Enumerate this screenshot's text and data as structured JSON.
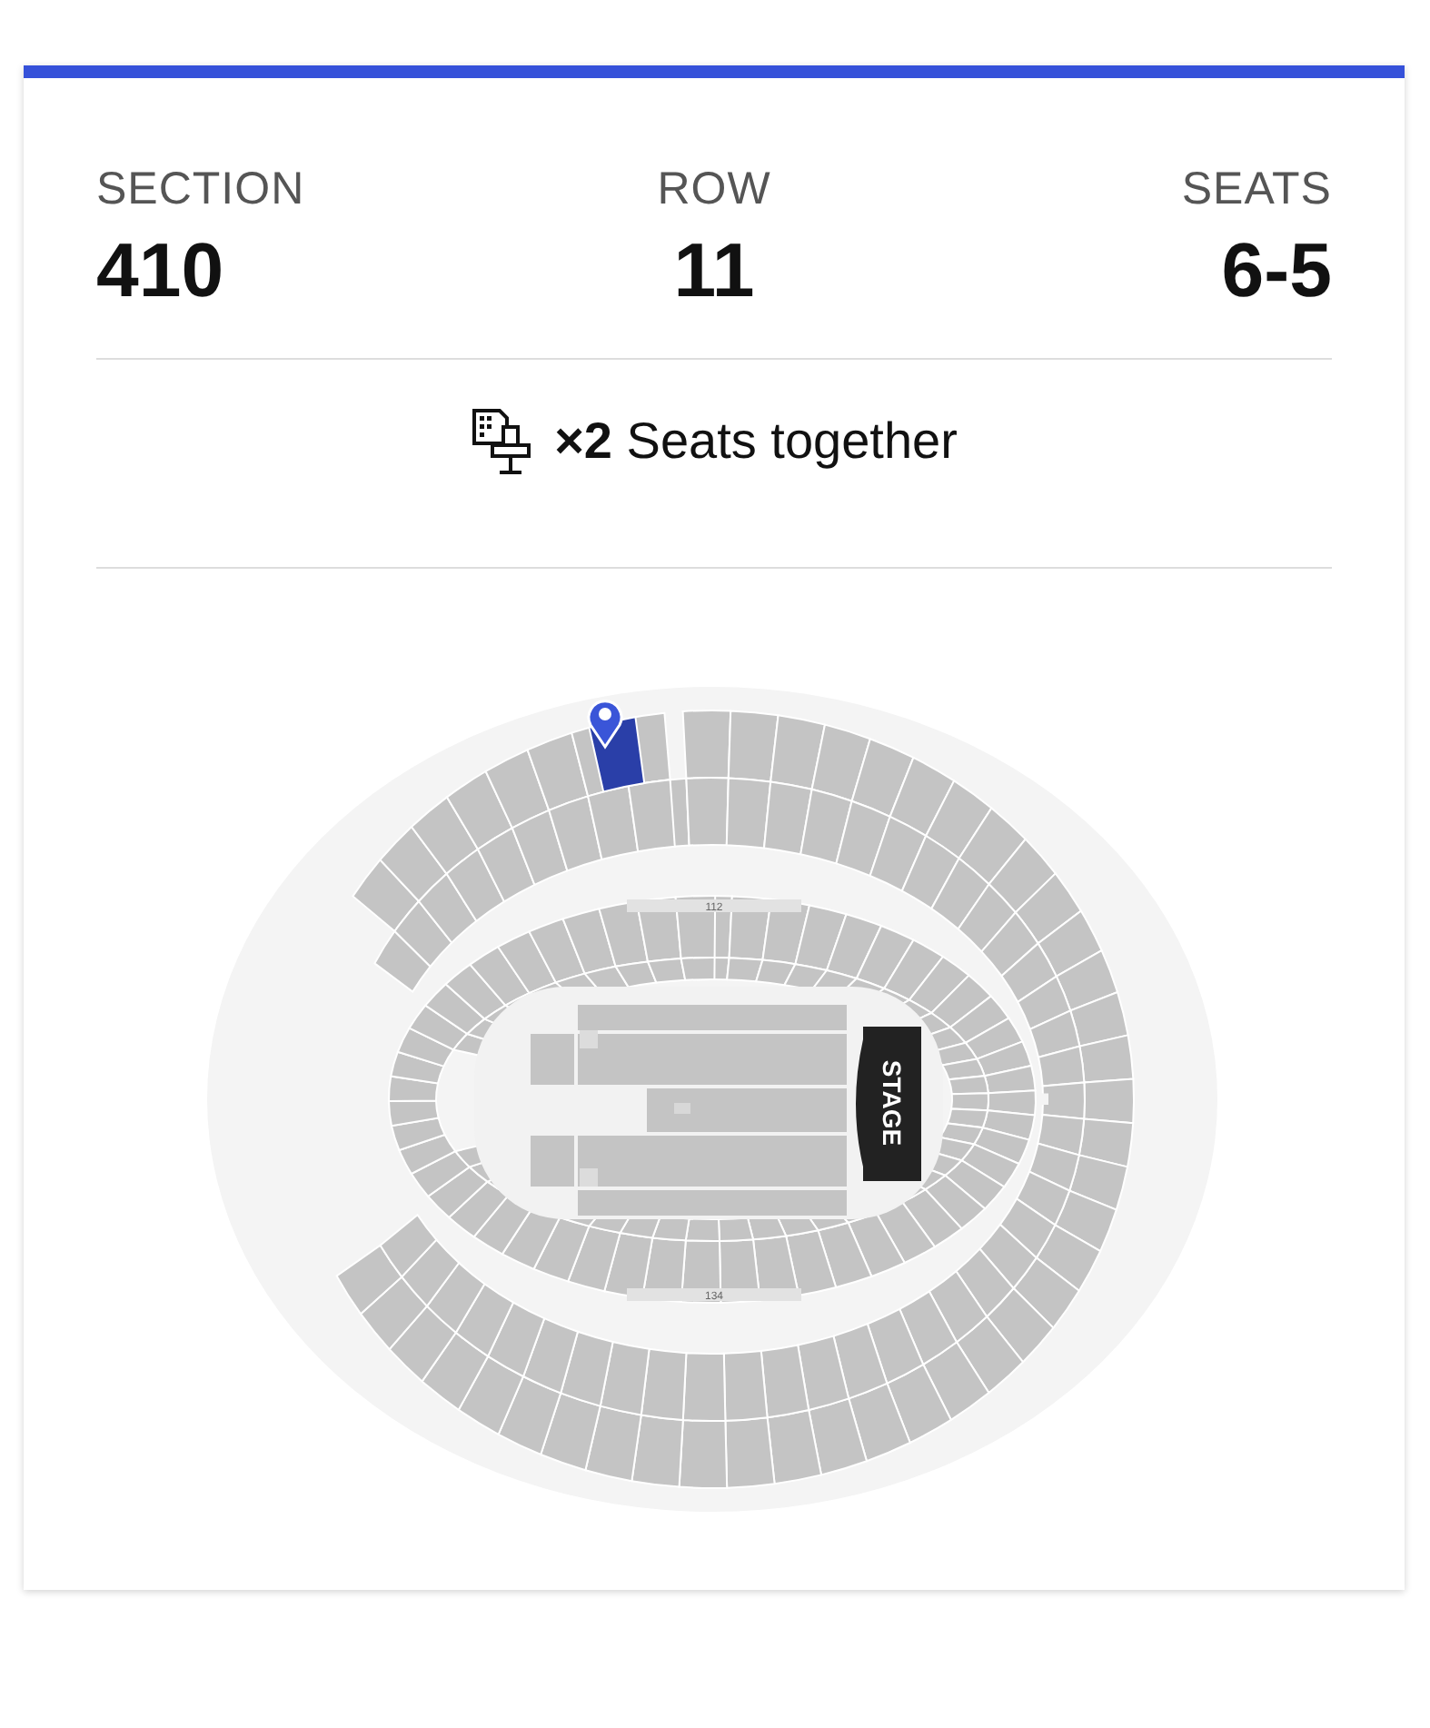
{
  "summary": [
    {
      "label": "SECTION",
      "value": "410"
    },
    {
      "label": "ROW",
      "value": "11"
    },
    {
      "label": "SEATS",
      "value": "6-5"
    }
  ],
  "feature": {
    "count": "×2",
    "text": "Seats together"
  },
  "map": {
    "stage_label": "STAGE",
    "section_labels": [
      "112",
      "134"
    ]
  }
}
